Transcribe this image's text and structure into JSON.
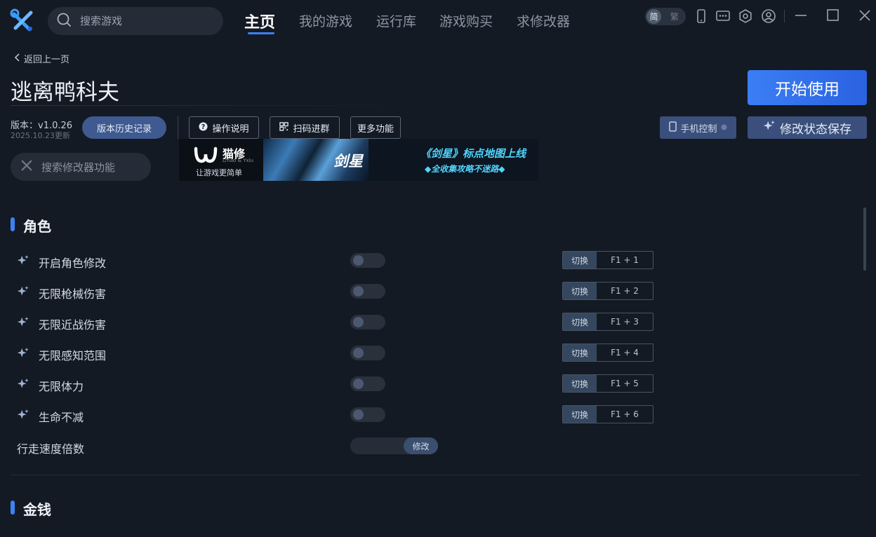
{
  "topbar": {
    "search_placeholder": "搜索游戏",
    "nav": [
      {
        "label": "主页",
        "active": true
      },
      {
        "label": "我的游戏",
        "active": false
      },
      {
        "label": "运行库",
        "active": false
      },
      {
        "label": "游戏购买",
        "active": false
      },
      {
        "label": "求修改器",
        "active": false
      }
    ],
    "lang": {
      "simplified": "简",
      "traditional": "繁",
      "selected": "简"
    },
    "icons": [
      "phone-icon",
      "chat-icon",
      "settings-icon",
      "user-icon",
      "minimize-icon",
      "maximize-icon",
      "close-icon"
    ],
    "accent_color": "#3b82f6"
  },
  "header": {
    "back_label": "返回上一页",
    "game_title": "逃离鸭科夫",
    "start_label": "开始使用",
    "version": "版本：v1.0.26",
    "update_date": "2025.10.23更新",
    "history_label": "版本历史记录",
    "guide_label": "操作说明",
    "qr_label": "扫码进群",
    "more_label": "更多功能",
    "phone_control_label": "手机控制",
    "save_state_label": "修改状态保存",
    "mod_search_placeholder": "搜索修改器功能"
  },
  "ad": {
    "brand": "猫修",
    "brand_sub": "Lmao & Yxiu",
    "slogan": "让游戏更简单",
    "game_logo": "剑星",
    "line1": "《剑星》标点地图上线",
    "line2": "◆全收集攻略不迷路◆"
  },
  "sections": [
    {
      "title": "角色",
      "items": [
        {
          "label": "开启角色修改",
          "enabled": false,
          "switch_label": "切换",
          "hotkey": "F1 + 1"
        },
        {
          "label": "无限枪械伤害",
          "enabled": false,
          "switch_label": "切换",
          "hotkey": "F1 + 2"
        },
        {
          "label": "无限近战伤害",
          "enabled": false,
          "switch_label": "切换",
          "hotkey": "F1 + 3"
        },
        {
          "label": "无限感知范围",
          "enabled": false,
          "switch_label": "切换",
          "hotkey": "F1 + 4"
        },
        {
          "label": "无限体力",
          "enabled": false,
          "switch_label": "切换",
          "hotkey": "F1 + 5"
        },
        {
          "label": "生命不减",
          "enabled": false,
          "switch_label": "切换",
          "hotkey": "F1 + 6"
        }
      ],
      "value_item": {
        "label": "行走速度倍数",
        "value": "",
        "button_label": "修改"
      }
    },
    {
      "title": "金钱",
      "items": []
    }
  ]
}
